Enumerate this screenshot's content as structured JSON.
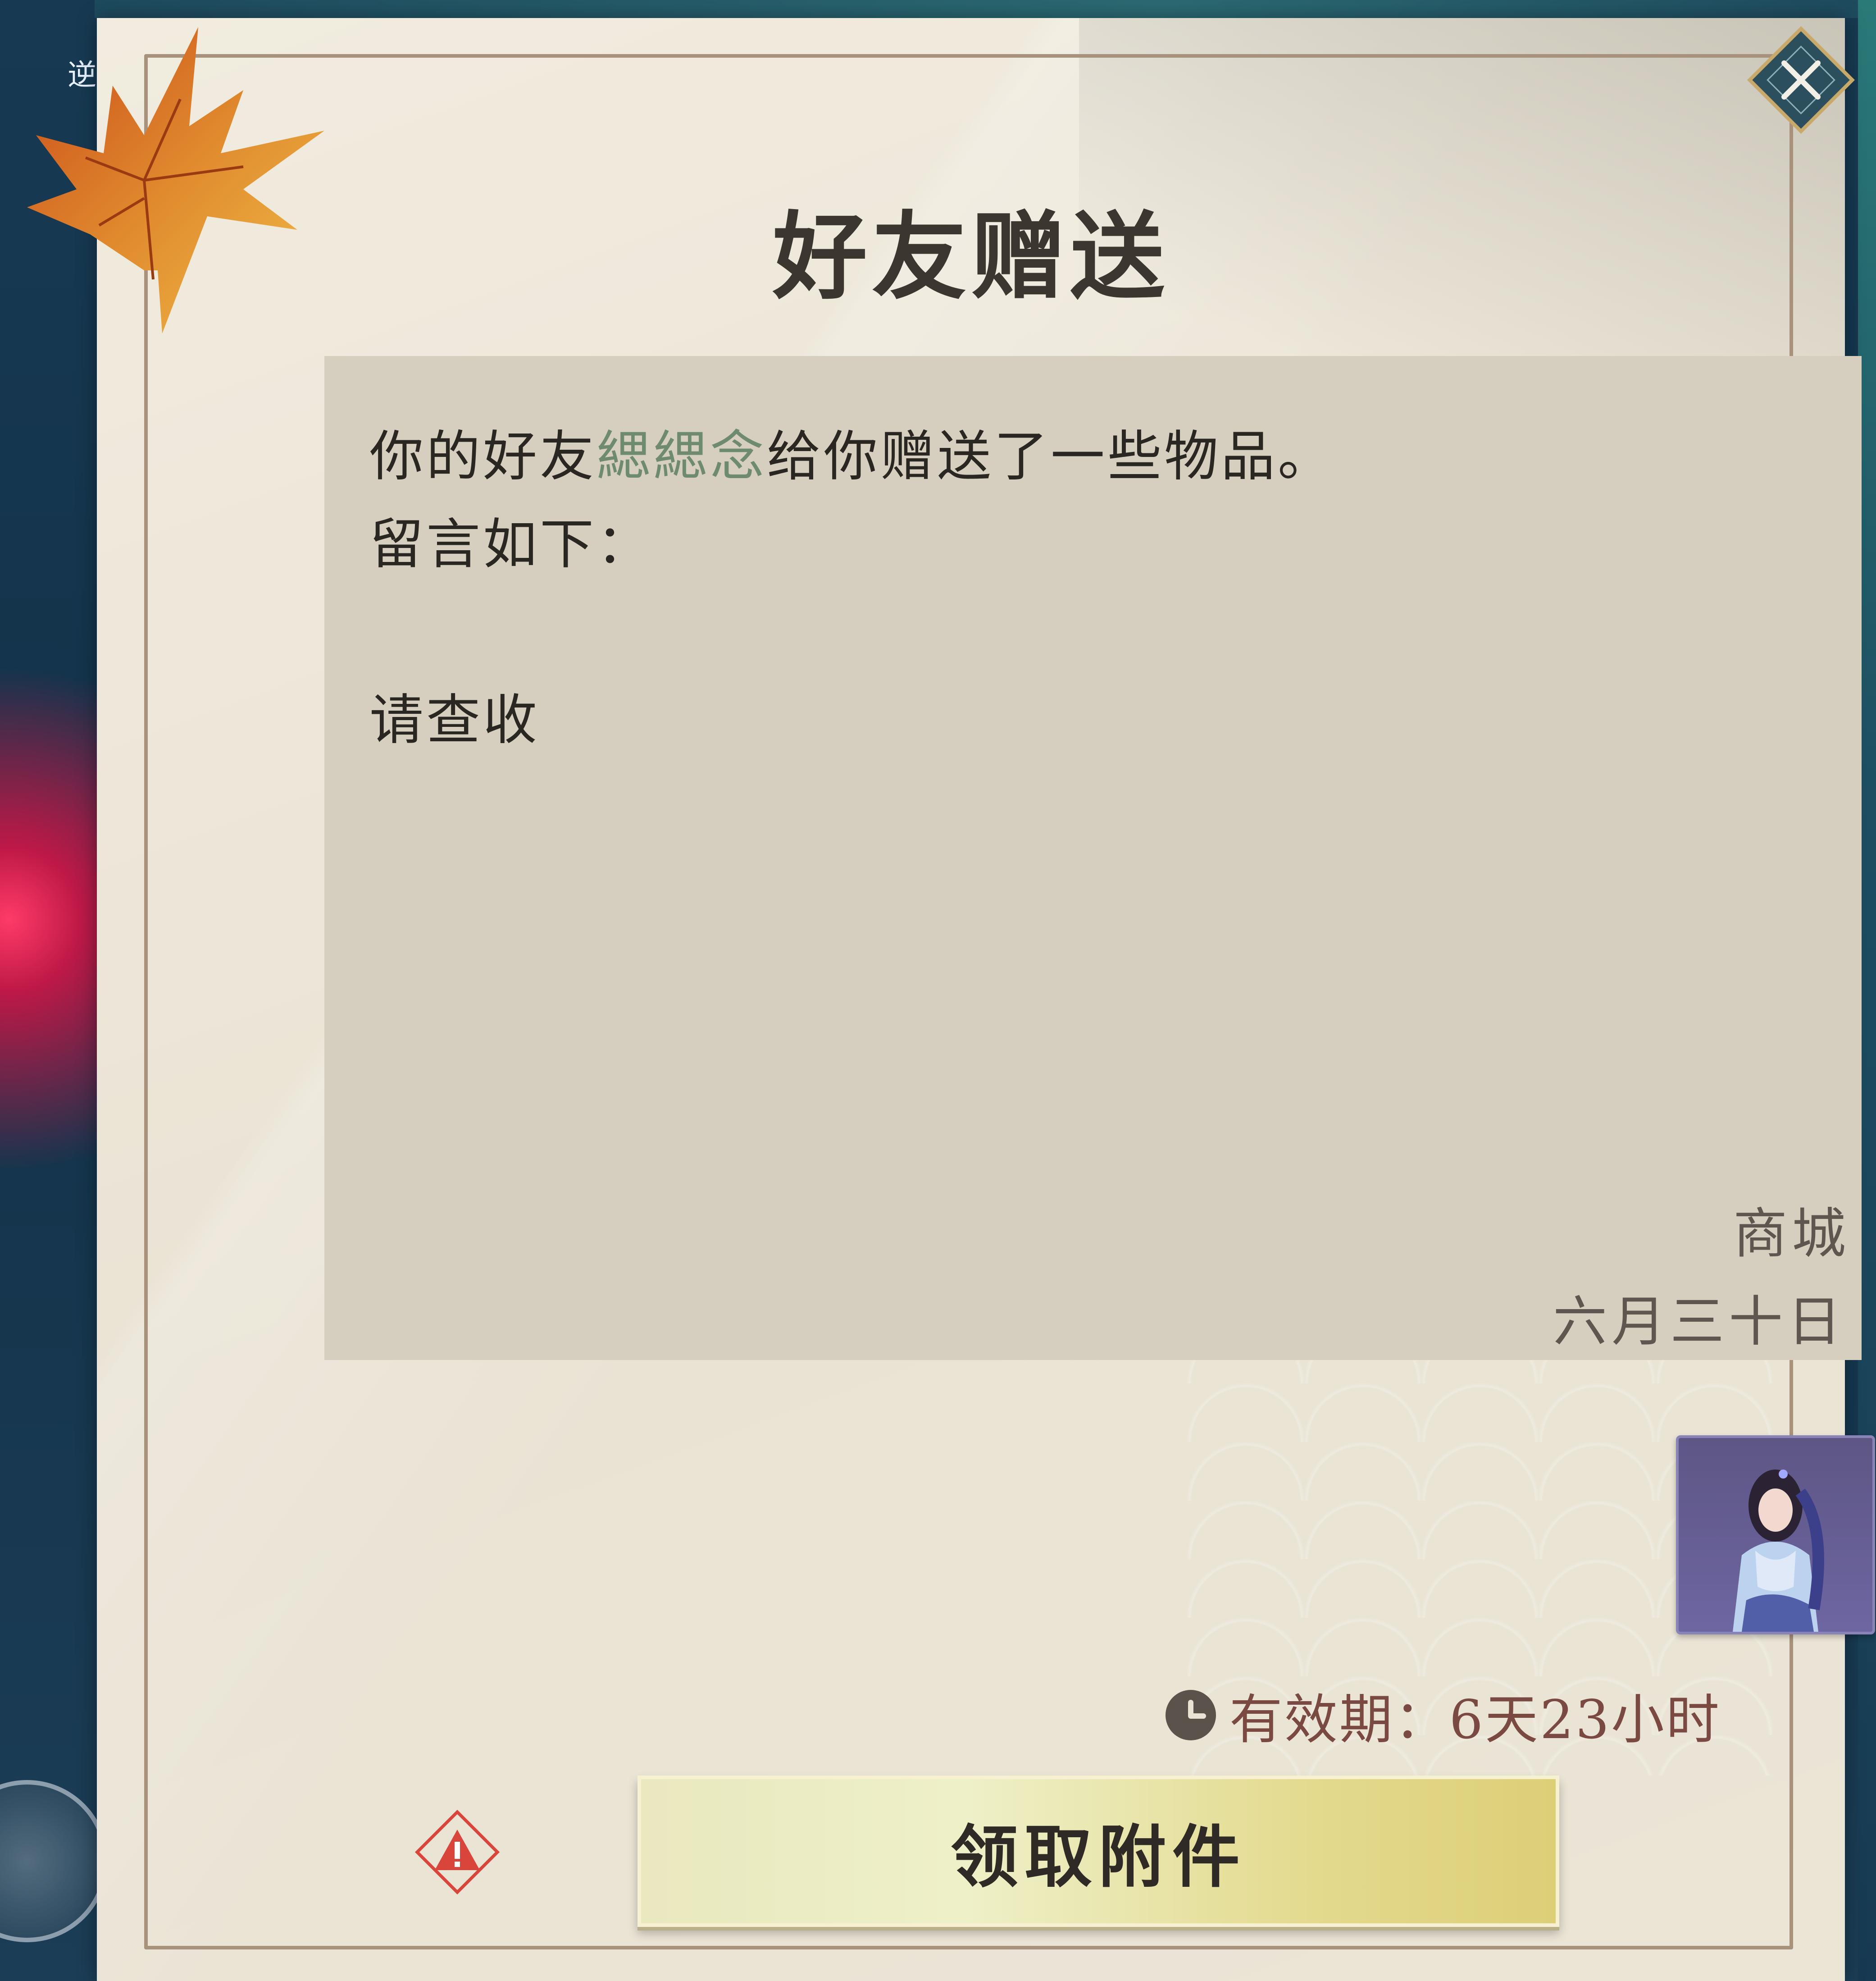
{
  "dialog": {
    "title": "好友赠送",
    "close_icon": "close-x-icon"
  },
  "letter": {
    "line1_prefix": "你的好友",
    "friend_name": "緦緦念",
    "line1_suffix": "给你赠送了一些物品。",
    "line2": "留言如下：",
    "message": "请查收",
    "sender": "商城",
    "date": "六月三十日"
  },
  "attachment": {
    "item_icon": "costume-portrait-icon"
  },
  "validity": {
    "icon": "clock-icon",
    "text": "有效期：6天23小时"
  },
  "actions": {
    "report_icon": "warning-report-icon",
    "claim_label": "领取附件"
  },
  "scene": {
    "left_glyph": "逆"
  },
  "colors": {
    "paper": "#e9e3d4",
    "letter_panel": "#d6cfbf",
    "friend_name": "#6e8b70",
    "validity_text": "#7a4a42",
    "claim_button": "#e3d98c",
    "report_icon": "#d9453a"
  }
}
